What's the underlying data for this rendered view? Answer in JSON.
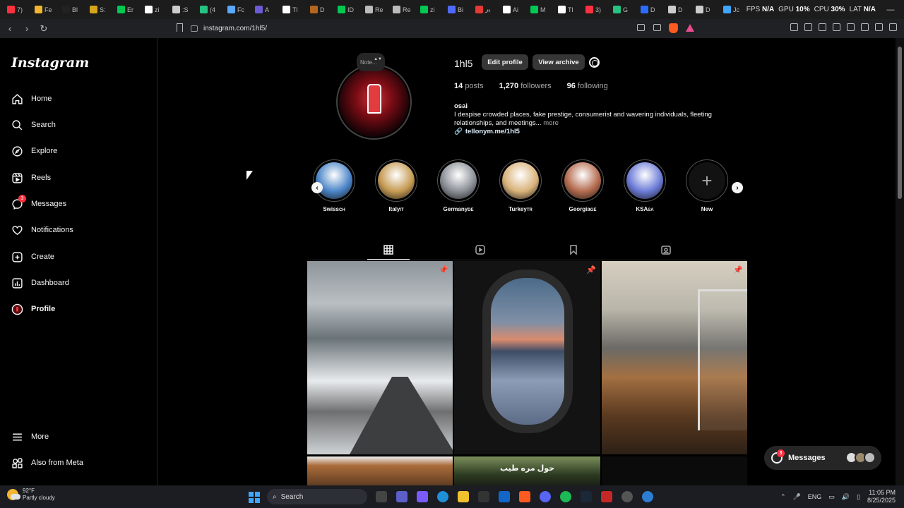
{
  "browser": {
    "tabs": [
      {
        "label": "7)",
        "color": "#ff3040"
      },
      {
        "label": "Fe",
        "color": "#f2b52f"
      },
      {
        "label": "Bl",
        "color": "#222222"
      },
      {
        "label": "S:",
        "color": "#d6a518"
      },
      {
        "label": "Er",
        "color": "#00c853"
      },
      {
        "label": "zi",
        "color": "#ffffff"
      },
      {
        "label": ":S",
        "color": "#cccccc"
      },
      {
        "label": "(4",
        "color": "#26c281"
      },
      {
        "label": "Fc",
        "color": "#5aa9ff"
      },
      {
        "label": "A",
        "color": "#6b5bd6"
      },
      {
        "label": "Tl",
        "color": "#ffffff"
      },
      {
        "label": "D",
        "color": "#b5651d"
      },
      {
        "label": "ID",
        "color": "#00c853"
      },
      {
        "label": "Re",
        "color": "#bbbbbb"
      },
      {
        "label": "Re",
        "color": "#bbbbbb"
      },
      {
        "label": "zi",
        "color": "#00c853"
      },
      {
        "label": "Bi",
        "color": "#4f6bff"
      },
      {
        "label": "ير",
        "color": "#e53935"
      },
      {
        "label": "Ai",
        "color": "#ffffff"
      },
      {
        "label": "M",
        "color": "#00c853"
      },
      {
        "label": "Tl",
        "color": "#ffffff"
      },
      {
        "label": "3)",
        "color": "#ff3040"
      },
      {
        "label": "G",
        "color": "#26c281"
      },
      {
        "label": "D",
        "color": "#2b6cff"
      },
      {
        "label": "D",
        "color": "#cccccc"
      },
      {
        "label": "D",
        "color": "#cccccc"
      },
      {
        "label": "Jc",
        "color": "#3ea6ff"
      }
    ],
    "perf": {
      "fps_label": "FPS",
      "fps_value": "N/A",
      "gpu_label": "GPU",
      "gpu_value": "10%",
      "cpu_label": "CPU",
      "cpu_value": "30%",
      "lat_label": "LAT",
      "lat_value": "N/A"
    },
    "url": "instagram.com/1hl5/"
  },
  "sidebar": {
    "logo": "Instagram",
    "items": [
      {
        "label": "Home",
        "icon": "home-icon"
      },
      {
        "label": "Search",
        "icon": "search-icon"
      },
      {
        "label": "Explore",
        "icon": "compass-icon"
      },
      {
        "label": "Reels",
        "icon": "reels-icon"
      },
      {
        "label": "Messages",
        "icon": "messenger-icon",
        "badge": "3"
      },
      {
        "label": "Notifications",
        "icon": "heart-icon"
      },
      {
        "label": "Create",
        "icon": "plus-square-icon"
      },
      {
        "label": "Dashboard",
        "icon": "chart-icon"
      },
      {
        "label": "Profile",
        "icon": "avatar-icon"
      }
    ],
    "more_label": "More",
    "meta_label": "Also from Meta"
  },
  "profile": {
    "note": "Note...",
    "username": "1hl5",
    "edit_label": "Edit profile",
    "archive_label": "View archive",
    "stats": {
      "posts": "14",
      "posts_label": "posts",
      "followers": "1,270",
      "followers_label": "followers",
      "following": "96",
      "following_label": "following"
    },
    "bio_name": "osai",
    "bio_text": "I despise crowded places, fake prestige, consumerist and wavering individuals, fleeting relationships, and meetings...",
    "bio_more": "more",
    "bio_link": "tellonym.me/1hl5"
  },
  "highlights": [
    {
      "label": "Swiss",
      "flag": "CH",
      "color": "#4a84c7"
    },
    {
      "label": "Italy",
      "flag": "IT",
      "color": "#c59a52"
    },
    {
      "label": "Germany",
      "flag": "DE",
      "color": "#8a8f96"
    },
    {
      "label": "Turkey",
      "flag": "TR",
      "color": "#d9b27a"
    },
    {
      "label": "Georgia",
      "flag": "GE",
      "color": "#b36b4e"
    },
    {
      "label": "KSA",
      "flag": "SA",
      "color": "#6b7bd6"
    },
    {
      "label": "New",
      "flag": "",
      "color": "#121212"
    }
  ],
  "posts": {
    "row2_caption": "حول مره طيب"
  },
  "messages_pill": {
    "label": "Messages",
    "badge": "3"
  },
  "taskbar": {
    "weather_temp": "92°F",
    "weather_desc": "Partly cloudy",
    "search_placeholder": "Search",
    "lang": "ENG",
    "time": "11:05 PM",
    "date": "8/25/2025"
  }
}
